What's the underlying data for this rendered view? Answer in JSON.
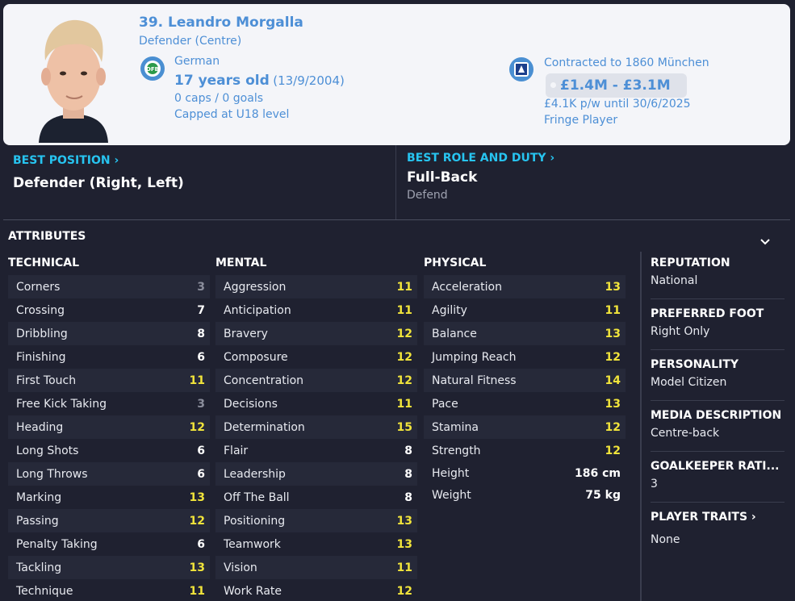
{
  "header": {
    "name": "39. Leandro Morgalla",
    "position": "Defender (Centre)",
    "nationality": "German",
    "age": "17 years old",
    "dob": "(13/9/2004)",
    "caps": "0 caps / 0 goals",
    "capped_level": "Capped at U18 level",
    "contract": "Contracted to 1860 München",
    "value": "£1.4M - £3.1M",
    "wage": "£4.1K p/w until 30/6/2025",
    "squad_status": "Fringe Player"
  },
  "best_position": {
    "label": "BEST POSITION ›",
    "value": "Defender (Right, Left)"
  },
  "best_role": {
    "label": "BEST ROLE AND DUTY ›",
    "value": "Full-Back",
    "duty": "Defend"
  },
  "attributes_title": "ATTRIBUTES",
  "technical": {
    "title": "TECHNICAL",
    "items": [
      {
        "name": "Corners",
        "value": "3"
      },
      {
        "name": "Crossing",
        "value": "7"
      },
      {
        "name": "Dribbling",
        "value": "8"
      },
      {
        "name": "Finishing",
        "value": "6"
      },
      {
        "name": "First Touch",
        "value": "11"
      },
      {
        "name": "Free Kick Taking",
        "value": "3"
      },
      {
        "name": "Heading",
        "value": "12"
      },
      {
        "name": "Long Shots",
        "value": "6"
      },
      {
        "name": "Long Throws",
        "value": "6"
      },
      {
        "name": "Marking",
        "value": "13"
      },
      {
        "name": "Passing",
        "value": "12"
      },
      {
        "name": "Penalty Taking",
        "value": "6"
      },
      {
        "name": "Tackling",
        "value": "13"
      },
      {
        "name": "Technique",
        "value": "11"
      }
    ]
  },
  "mental": {
    "title": "MENTAL",
    "items": [
      {
        "name": "Aggression",
        "value": "11"
      },
      {
        "name": "Anticipation",
        "value": "11"
      },
      {
        "name": "Bravery",
        "value": "12"
      },
      {
        "name": "Composure",
        "value": "12"
      },
      {
        "name": "Concentration",
        "value": "12"
      },
      {
        "name": "Decisions",
        "value": "11"
      },
      {
        "name": "Determination",
        "value": "15"
      },
      {
        "name": "Flair",
        "value": "8"
      },
      {
        "name": "Leadership",
        "value": "8"
      },
      {
        "name": "Off The Ball",
        "value": "8"
      },
      {
        "name": "Positioning",
        "value": "13"
      },
      {
        "name": "Teamwork",
        "value": "13"
      },
      {
        "name": "Vision",
        "value": "11"
      },
      {
        "name": "Work Rate",
        "value": "12"
      }
    ]
  },
  "physical": {
    "title": "PHYSICAL",
    "items": [
      {
        "name": "Acceleration",
        "value": "13"
      },
      {
        "name": "Agility",
        "value": "11"
      },
      {
        "name": "Balance",
        "value": "13"
      },
      {
        "name": "Jumping Reach",
        "value": "12"
      },
      {
        "name": "Natural Fitness",
        "value": "14"
      },
      {
        "name": "Pace",
        "value": "13"
      },
      {
        "name": "Stamina",
        "value": "12"
      },
      {
        "name": "Strength",
        "value": "12"
      }
    ],
    "height_label": "Height",
    "height": "186 cm",
    "weight_label": "Weight",
    "weight": "75 kg"
  },
  "info": {
    "reputation_label": "REPUTATION",
    "reputation": "National",
    "foot_label": "PREFERRED FOOT",
    "foot": "Right Only",
    "personality_label": "PERSONALITY",
    "personality": "Model Citizen",
    "media_label": "MEDIA DESCRIPTION",
    "media": "Centre-back",
    "gk_label": "GOALKEEPER RATI...",
    "gk": "3",
    "traits_label": "PLAYER TRAITS ›",
    "traits": "None"
  },
  "colors": {
    "accent_blue": "#4d8fd6",
    "best_cyan": "#27c4f0",
    "attr_high": "#f1e43b",
    "attr_low": "#8b8e9c"
  },
  "icons": [
    "player-portrait",
    "german-fa-badge",
    "club-badge-1860",
    "chevron-down-icon"
  ]
}
